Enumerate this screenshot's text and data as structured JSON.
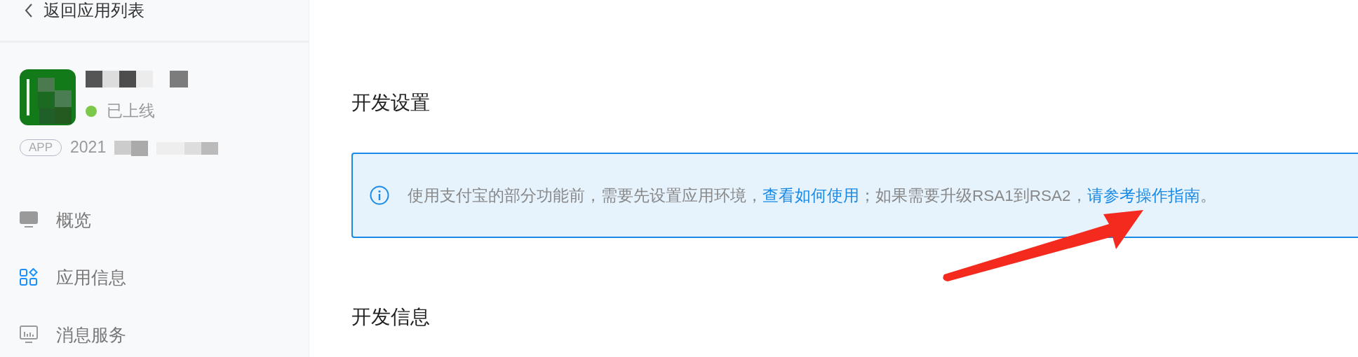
{
  "sidebar": {
    "back_link": "返回应用列表",
    "app": {
      "status": {
        "label": "已上线",
        "color": "#7cc84a"
      },
      "app_type_badge": "APP",
      "app_id": "2021"
    },
    "nav_items": [
      {
        "label": "概览",
        "kind": "overview",
        "selected": false
      },
      {
        "label": "应用信息",
        "kind": "apps",
        "selected": true
      },
      {
        "label": "消息服务",
        "kind": "messages",
        "selected": false
      }
    ]
  },
  "main": {
    "sections": [
      {
        "title": "开发设置"
      },
      {
        "title": "开发信息"
      }
    ],
    "notice": {
      "segments": [
        {
          "kind": "text",
          "text": "使用支付宝的部分功能前，需要先设置应用环境，"
        },
        {
          "kind": "link",
          "text": "查看如何使用"
        },
        {
          "kind": "text",
          "text": "；如果需要升级RSA1到RSA2，"
        },
        {
          "kind": "link",
          "text": "请参考操作指南"
        },
        {
          "kind": "text",
          "text": "。"
        }
      ]
    }
  }
}
